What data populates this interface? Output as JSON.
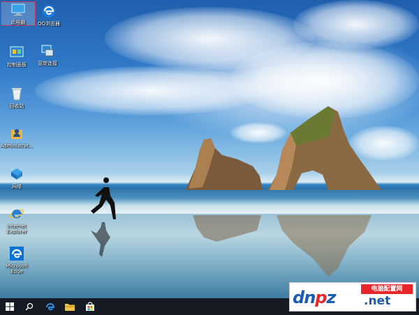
{
  "desktop": {
    "icons": [
      {
        "label": "此电脑",
        "icon": "computer-icon",
        "selected": true
      },
      {
        "label": "QQ浏览器",
        "icon": "qq-browser-icon",
        "selected": false
      },
      {
        "label": "控制面板",
        "icon": "control-panel-icon",
        "selected": false
      },
      {
        "label": "宽带连接",
        "icon": "broadband-connection-icon",
        "selected": false
      },
      {
        "label": "回收站",
        "icon": "recycle-bin-icon",
        "selected": false
      },
      {
        "label": "Administrat...",
        "icon": "user-folder-icon",
        "selected": false
      },
      {
        "label": "网络",
        "icon": "network-icon",
        "selected": false
      },
      {
        "label": "Internet Explorer",
        "icon": "internet-explorer-icon",
        "selected": false
      },
      {
        "label": "Microsoft Edge",
        "icon": "edge-icon",
        "selected": false
      }
    ]
  },
  "taskbar": {
    "buttons": [
      {
        "name": "start",
        "icon": "windows-start-icon"
      },
      {
        "name": "search",
        "icon": "search-icon"
      },
      {
        "name": "edge",
        "icon": "edge-icon"
      },
      {
        "name": "file-explorer",
        "icon": "folder-icon"
      },
      {
        "name": "store",
        "icon": "store-icon"
      }
    ]
  },
  "watermark": {
    "logo_text": "dnpz",
    "badge": "电脑配置网",
    "domain": ".net"
  },
  "colors": {
    "taskbar_bg": "#161a22",
    "selection_border": "#c0395b",
    "watermark_red": "#e8262b",
    "watermark_blue": "#1a5db0"
  }
}
